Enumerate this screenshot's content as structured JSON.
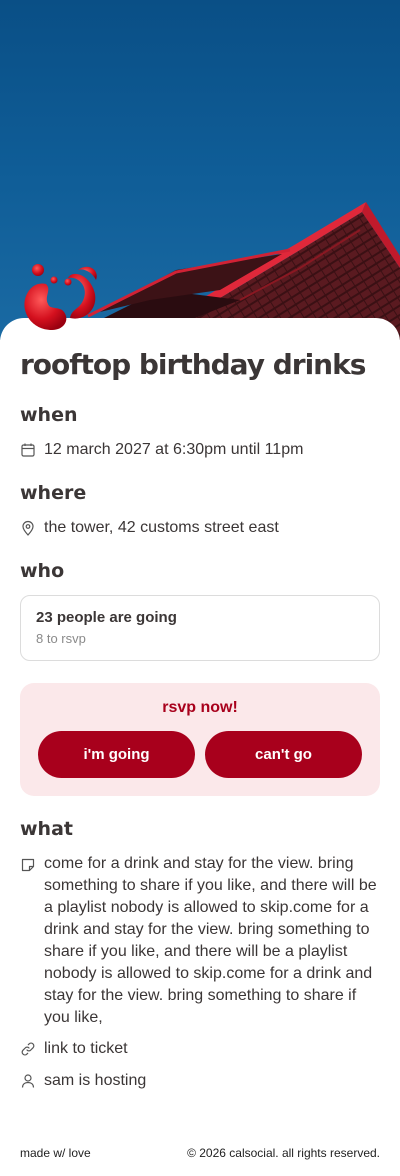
{
  "event": {
    "title": "rooftop birthday drinks"
  },
  "when": {
    "heading": "when",
    "datetime": "12 march 2027 at 6:30pm until 11pm",
    "icon": "calendar-icon"
  },
  "where": {
    "heading": "where",
    "location": "the tower, 42 customs street east",
    "icon": "map-pin-icon"
  },
  "who": {
    "heading": "who",
    "going": "23 people are going",
    "to_rsvp": "8 to rsvp"
  },
  "rsvp": {
    "heading": "rsvp now!",
    "going_label": "i'm going",
    "cant_label": "can't go"
  },
  "what": {
    "heading": "what",
    "description": "come for a drink and stay for the view. bring something to share if you like, and there will be a playlist nobody is allowed to skip.come for a drink and stay for the view. bring something to share if you like, and there will be a playlist nobody is allowed to skip.come for a drink and stay for the view. bring something to share if you like,",
    "ticket_link": "link to ticket",
    "host": "sam is hosting"
  },
  "footer": {
    "left": "made w/ love",
    "right": "© 2026 calsocial. all rights reserved."
  },
  "colors": {
    "accent": "#a8001c",
    "rsvp_bg": "#fbe8ea",
    "sky": "#0e5a94"
  }
}
